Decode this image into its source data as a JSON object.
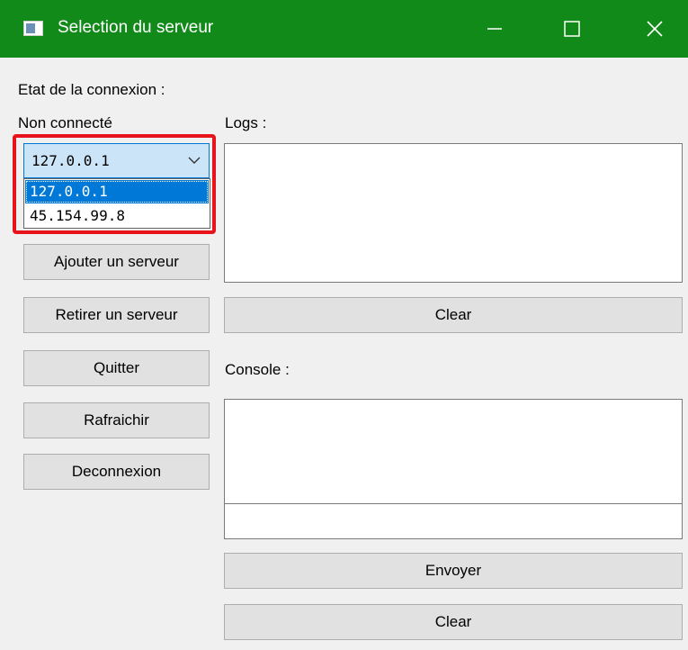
{
  "window": {
    "title": "Selection du serveur",
    "titlebar_color": "#128a1a",
    "minimize_icon": "minimize-icon",
    "maximize_icon": "maximize-icon",
    "close_icon": "close-icon"
  },
  "left": {
    "status_label": "Etat de la connexion :",
    "status_value": "Non connecté",
    "server_select": {
      "value": "127.0.0.1",
      "options": [
        "127.0.0.1",
        "45.154.99.8"
      ],
      "selected_index": 0,
      "expanded": true
    },
    "buttons": {
      "add": "Ajouter un serveur",
      "remove": "Retirer un serveur",
      "quit": "Quitter",
      "refresh": "Rafraichir",
      "disconnect": "Deconnexion"
    }
  },
  "right": {
    "logs_label": "Logs :",
    "logs_text": "",
    "logs_clear": "Clear",
    "console_label": "Console :",
    "console_output": "",
    "console_input": "",
    "send": "Envoyer",
    "console_clear": "Clear"
  },
  "highlight_color": "#e8141b"
}
